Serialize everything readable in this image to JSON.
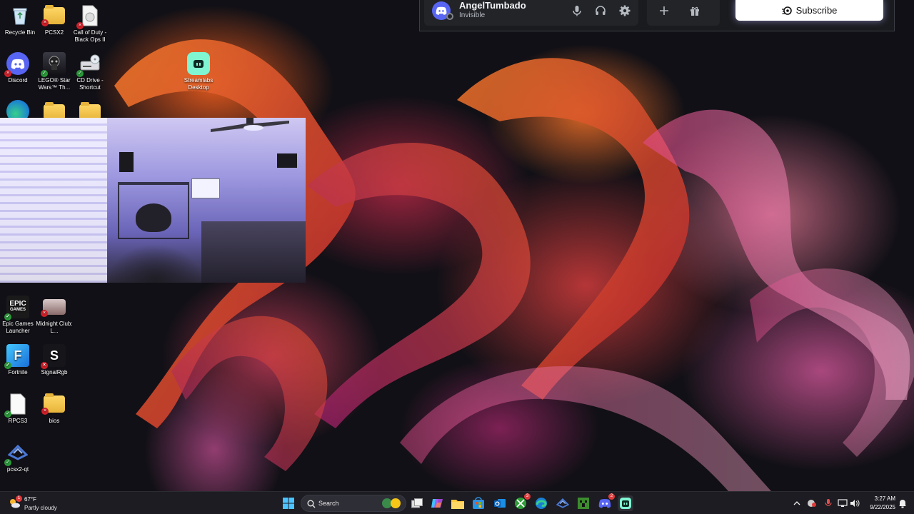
{
  "desktop": {
    "icons": [
      {
        "label": "Recycle Bin",
        "icon": "recycle-bin-icon",
        "badge": "none"
      },
      {
        "label": "PCSX2",
        "icon": "folder-icon",
        "badge": "error"
      },
      {
        "label": "Call of Duty - Black Ops II",
        "icon": "file-icon",
        "badge": "error"
      },
      {
        "label": "Discord",
        "icon": "discord-icon",
        "badge": "error"
      },
      {
        "label": "LEGO® Star Wars™ Th...",
        "icon": "lego-star-wars-icon",
        "badge": "ok"
      },
      {
        "label": "CD Drive - Shortcut",
        "icon": "cd-drive-icon",
        "badge": "ok"
      },
      {
        "label": "Streamlabs Desktop",
        "icon": "streamlabs-icon",
        "badge": "none"
      },
      {
        "label": "Epic Games Launcher",
        "icon": "epic-games-icon",
        "badge": "ok"
      },
      {
        "label": "Midnight Club: L...",
        "icon": "midnight-club-icon",
        "badge": "error"
      },
      {
        "label": "Fortnite",
        "icon": "fortnite-icon",
        "badge": "ok"
      },
      {
        "label": "SignalRgb",
        "icon": "signalrgb-icon",
        "badge": "error"
      },
      {
        "label": "RPCS3",
        "icon": "file-icon",
        "badge": "ok"
      },
      {
        "label": "bios",
        "icon": "folder-icon",
        "badge": "error"
      },
      {
        "label": "pcsx2-qt",
        "icon": "pcsx2-icon",
        "badge": "ok"
      }
    ]
  },
  "discord": {
    "username": "AngelTumbado",
    "status": "Invisible",
    "subscribe_label": "Subscribe",
    "colors": {
      "blurple": "#5865f2",
      "panel": "#232428"
    }
  },
  "taskbar": {
    "weather": {
      "temp": "67°F",
      "condition": "Partly cloudy",
      "badge": "1"
    },
    "search_placeholder": "Search",
    "pinned": [
      {
        "name": "widgets-icon"
      },
      {
        "name": "task-view-icon"
      },
      {
        "name": "copilot-icon"
      },
      {
        "name": "file-explorer-icon"
      },
      {
        "name": "microsoft-store-icon"
      },
      {
        "name": "outlook-icon"
      },
      {
        "name": "xbox-icon",
        "badge": "3"
      },
      {
        "name": "edge-icon"
      },
      {
        "name": "pcsx2-icon"
      },
      {
        "name": "minecraft-icon"
      },
      {
        "name": "discord-icon",
        "badge": "2"
      },
      {
        "name": "streamlabs-icon"
      }
    ],
    "clock": {
      "time": "3:27 AM",
      "date": "9/22/2025"
    }
  }
}
